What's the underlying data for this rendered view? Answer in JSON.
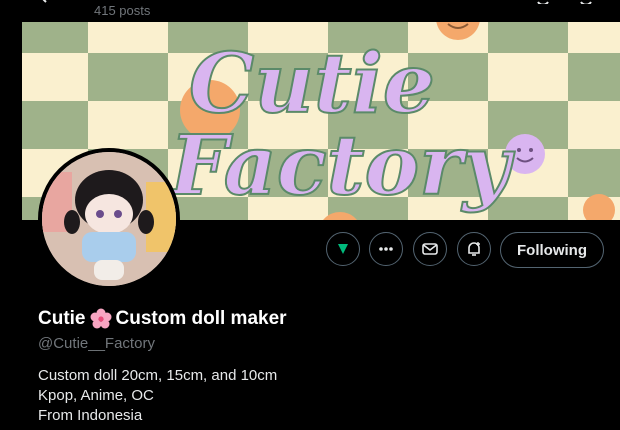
{
  "header": {
    "posts_count": "415 posts"
  },
  "banner": {
    "line1": "Cutie",
    "line2": "Factory"
  },
  "actions": {
    "follow_label": "Following"
  },
  "profile": {
    "display_name": "Cutie",
    "display_name_suffix": "Custom doll maker",
    "handle": "@Cutie__Factory",
    "bio": [
      "Custom doll 20cm, 15cm, and 10cm",
      "Kpop, Anime, OC",
      "From Indonesia"
    ]
  },
  "colors": {
    "background": "#000000",
    "banner_green": "#9fb28a",
    "banner_cream": "#faf0cf",
    "banner_lettering": "#d9b5f0",
    "smiley": "#f4a86b",
    "secondary_text": "#71767b",
    "subscribe_accent": "#00ba7c"
  },
  "icons": [
    "back-arrow-icon",
    "search-icon",
    "subscribe-icon",
    "more-icon",
    "message-icon",
    "notify-icon",
    "flower-emoji-icon"
  ]
}
